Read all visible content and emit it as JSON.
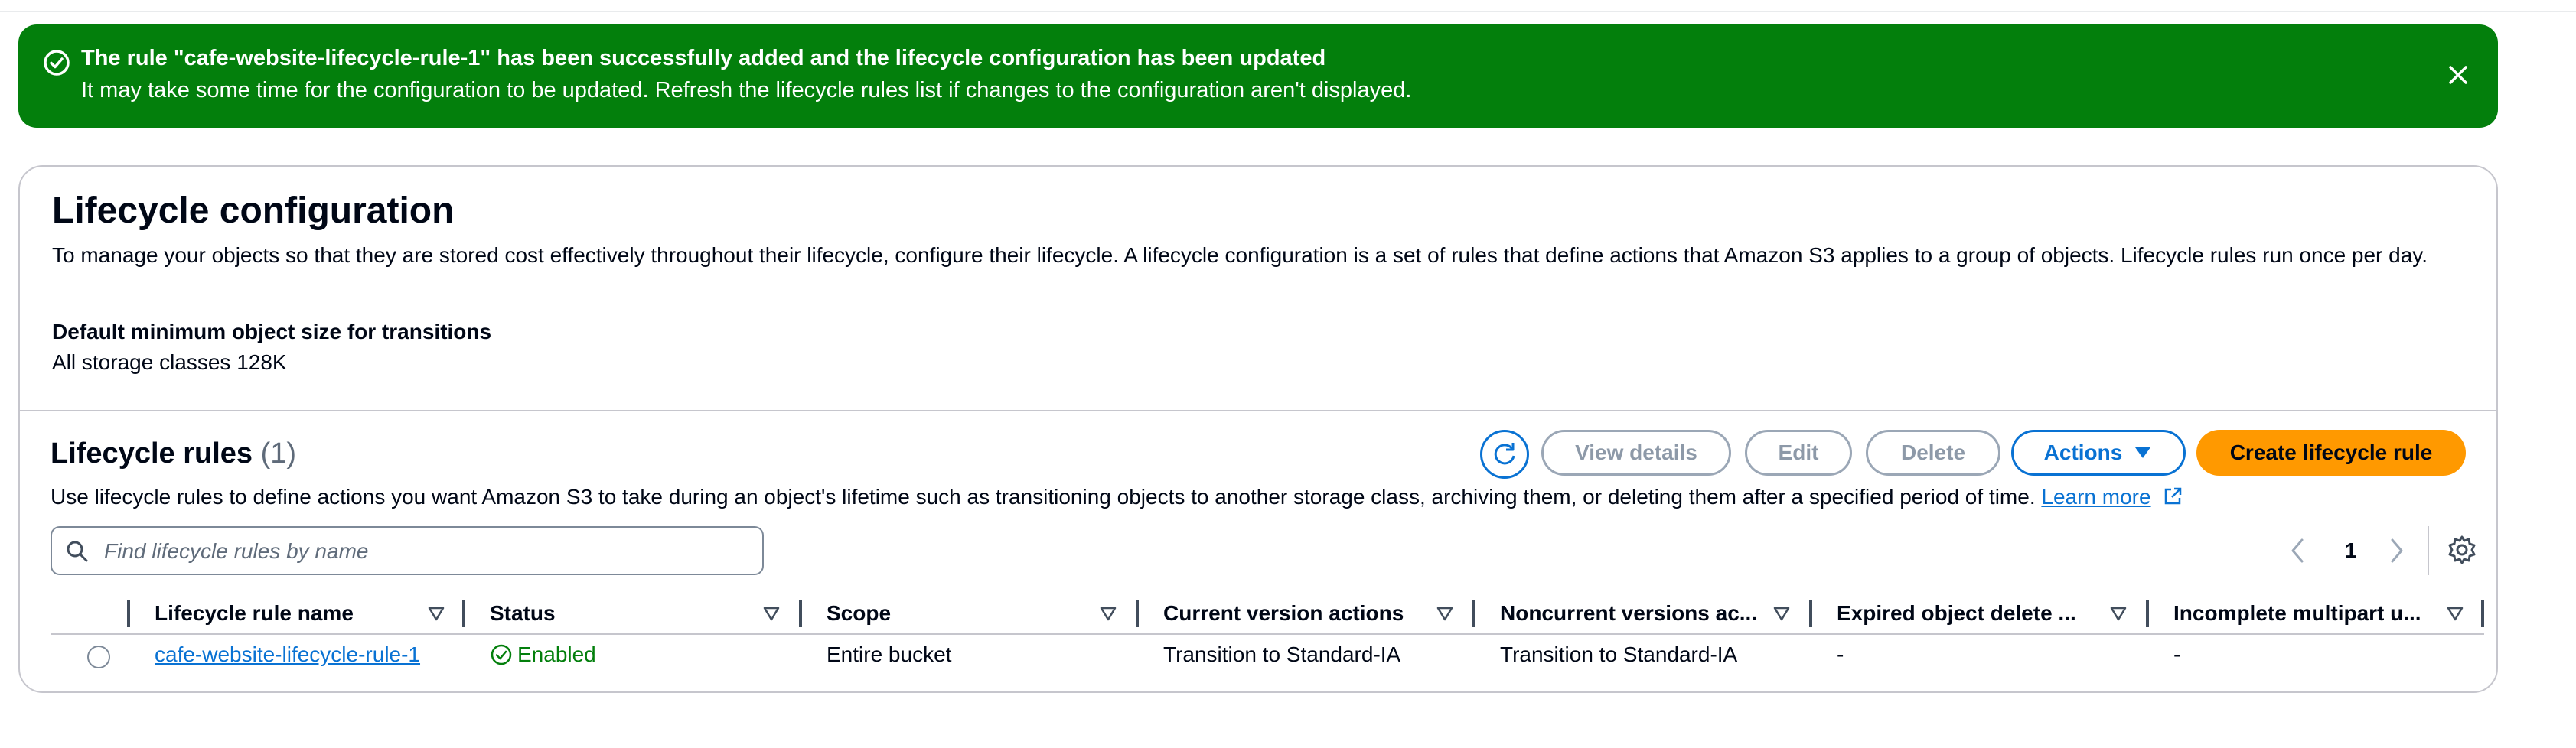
{
  "flash": {
    "title": "The rule \"cafe-website-lifecycle-rule-1\" has been successfully added and the lifecycle configuration has been updated",
    "message": "It may take some time for the configuration to be updated. Refresh the lifecycle rules list if changes to the configuration aren't displayed.",
    "icons": {
      "status": "success-check-icon",
      "dismiss": "close-icon"
    },
    "color": "#037f0c"
  },
  "config": {
    "title": "Lifecycle configuration",
    "description": "To manage your objects so that they are stored cost effectively throughout their lifecycle, configure their lifecycle. A lifecycle configuration is a set of rules that define actions that Amazon S3 applies to a group of objects. Lifecycle rules run once per day.",
    "min_size_label": "Default minimum object size for transitions",
    "min_size_value": "All storage classes 128K"
  },
  "rules": {
    "title": "Lifecycle rules",
    "count": "(1)",
    "description": "Use lifecycle rules to define actions you want Amazon S3 to take during an object's lifetime such as transitioning objects to another storage class, archiving them, or deleting them after a specified period of time.",
    "learn_more": "Learn more",
    "buttons": {
      "view_details": "View details",
      "edit": "Edit",
      "delete": "Delete",
      "actions": "Actions",
      "create": "Create lifecycle rule"
    },
    "search_placeholder": "Find lifecycle rules by name",
    "page": "1",
    "columns": [
      "Lifecycle rule name",
      "Status",
      "Scope",
      "Current version actions",
      "Noncurrent versions ac...",
      "Expired object delete ...",
      "Incomplete multipart u..."
    ],
    "rows": [
      {
        "name": "cafe-website-lifecycle-rule-1",
        "status": "Enabled",
        "scope": "Entire bucket",
        "current_actions": "Transition to Standard-IA",
        "noncurrent_actions": "Transition to Standard-IA",
        "expired_delete": "-",
        "incomplete_multipart": "-"
      }
    ]
  },
  "colors": {
    "accent": "#0972d3",
    "primary_button": "#ff9900",
    "success": "#037f0c"
  }
}
